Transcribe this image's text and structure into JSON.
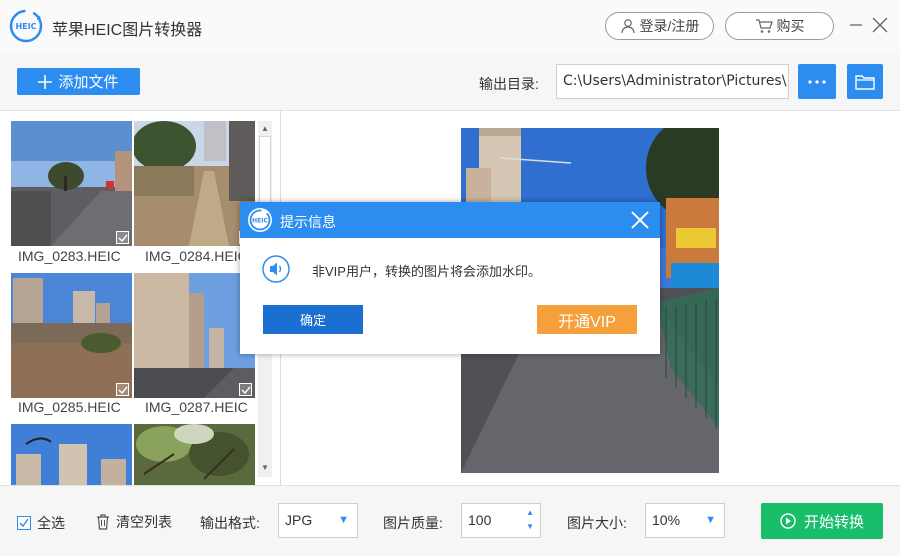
{
  "app": {
    "title": "苹果HEIC图片转换器",
    "logo_text": "HEIC"
  },
  "titlebar": {
    "login_label": "登录/注册",
    "buy_label": "购买"
  },
  "toolbar": {
    "add_file_label": "添加文件",
    "output_dir_label": "输出目录:",
    "output_dir_value": "C:\\Users\\Administrator\\Pictures\\",
    "more_label": "•••"
  },
  "thumbnails": [
    {
      "name": "IMG_0283.HEIC",
      "checked": true
    },
    {
      "name": "IMG_0284.HEIC",
      "checked": true
    },
    {
      "name": "IMG_0285.HEIC",
      "checked": true
    },
    {
      "name": "IMG_0287.HEIC",
      "checked": true
    },
    {
      "name": "",
      "checked": false
    },
    {
      "name": "",
      "checked": false
    }
  ],
  "bottombar": {
    "select_all_label": "全选",
    "clear_list_label": "清空列表",
    "format_label": "输出格式:",
    "format_value": "JPG",
    "quality_label": "图片质量:",
    "quality_value": "100",
    "size_label": "图片大小:",
    "size_value": "10%",
    "start_label": "开始转换"
  },
  "dialog": {
    "title": "提示信息",
    "message": "非VIP用户，转换的图片将会添加水印。",
    "ok_label": "确定",
    "vip_label": "开通VIP"
  },
  "colors": {
    "accent": "#2d8cf0",
    "start": "#19be6b",
    "vip": "#f5a03a",
    "ok": "#1a6fd1"
  }
}
